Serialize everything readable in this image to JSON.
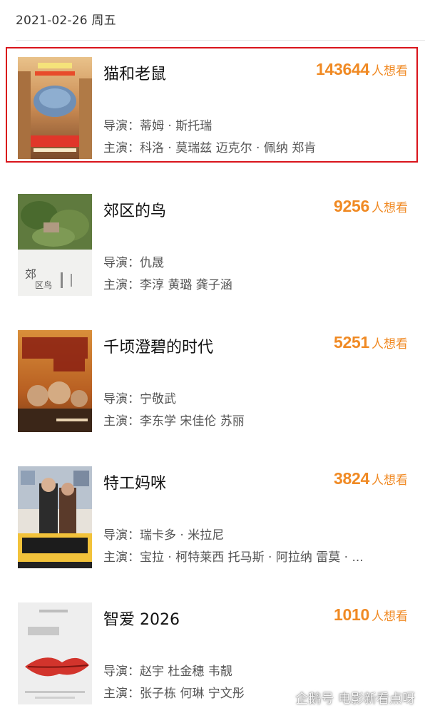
{
  "date_header": "2021-02-26 周五",
  "want_suffix": "人想看",
  "movies": [
    {
      "title": "猫和老鼠",
      "want_count": "143644",
      "director": "导演：蒂姆 · 斯托瑞",
      "cast": "主演：科洛 · 莫瑞兹 迈克尔 · 佩纳 郑肯"
    },
    {
      "title": "郊区的鸟",
      "want_count": "9256",
      "director": "导演：仇晟",
      "cast": "主演：李淳 黄璐 龚子涵"
    },
    {
      "title": "千顷澄碧的时代",
      "want_count": "5251",
      "director": "导演：宁敬武",
      "cast": "主演：李东学 宋佳伦 苏丽"
    },
    {
      "title": "特工妈咪",
      "want_count": "3824",
      "director": "导演：瑞卡多 · 米拉尼",
      "cast": "主演：宝拉 · 柯特莱西 托马斯 · 阿拉纳 雷莫 · ..."
    },
    {
      "title": "智爱 2026",
      "want_count": "1010",
      "director": "导演：赵宇  杜金穗  韦靓",
      "cast": "主演：张子栋 何琳 宁文彤"
    }
  ],
  "watermark": "企鹅号 电影新看点呀"
}
